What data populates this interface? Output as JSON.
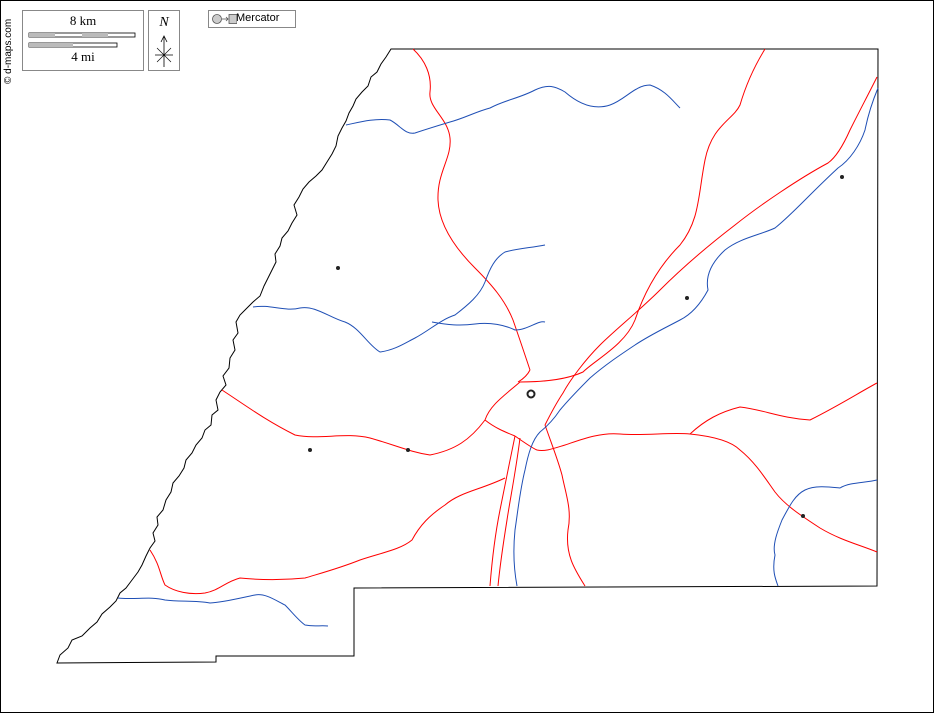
{
  "credit": "© d-maps.com",
  "scale": {
    "km_label": "8 km",
    "mi_label": "4 mi"
  },
  "north_arrow": {
    "label": "N"
  },
  "projection": {
    "label": "Mercator"
  },
  "colors": {
    "border": "#000000",
    "roads": "#ff0000",
    "rivers": "#1f4fb5",
    "towns": "#222222"
  }
}
